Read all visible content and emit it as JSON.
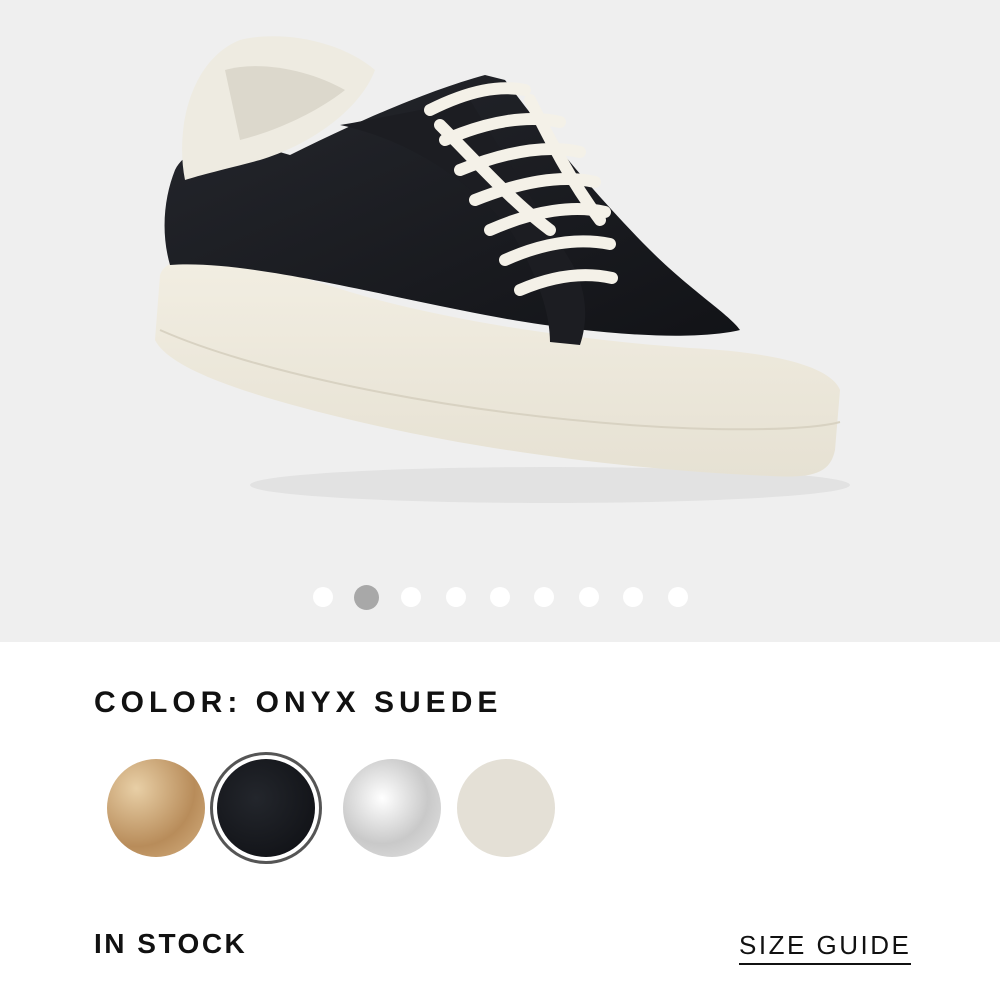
{
  "gallery": {
    "image_icon": "sneaker-product-photo",
    "background_color": "#efefef",
    "dots_total": 9,
    "active_dot_index": 1
  },
  "color": {
    "label": "COLOR: ONYX SUEDE"
  },
  "swatches": [
    {
      "name": "gold-metallic",
      "color": "#c9a57a",
      "selected": false
    },
    {
      "name": "onyx-suede",
      "color": "#111318",
      "selected": true
    },
    {
      "name": "silver-metallic",
      "color": "#d4d4d4",
      "selected": false
    },
    {
      "name": "cream-suede",
      "color": "#e4e0d6",
      "selected": false
    }
  ],
  "footer": {
    "stock": "IN STOCK",
    "size_guide": "SIZE GUIDE"
  }
}
